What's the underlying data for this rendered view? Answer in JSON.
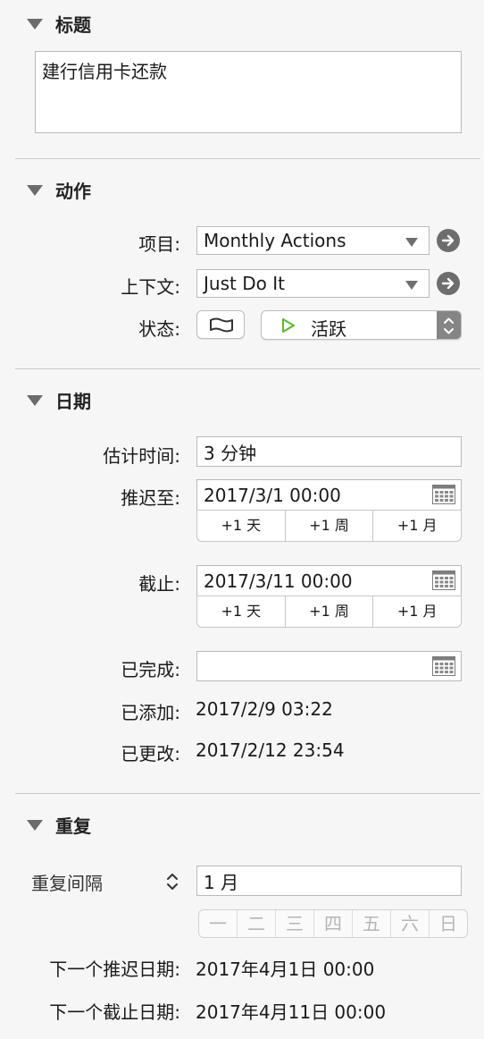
{
  "title_section": {
    "header": "标题",
    "title_value": "建行信用卡还款"
  },
  "action_section": {
    "header": "动作",
    "project_label": "项目:",
    "project_value": "Monthly Actions",
    "context_label": "上下文:",
    "context_value": "Just Do It",
    "status_label": "状态:",
    "status_value": "活跃"
  },
  "dates_section": {
    "header": "日期",
    "estimate_label": "估计时间:",
    "estimate_value": "3 分钟",
    "defer_label": "推迟至:",
    "defer_value": "2017/3/1 00:00",
    "due_label": "截止:",
    "due_value": "2017/3/11 00:00",
    "completed_label": "已完成:",
    "completed_value": "",
    "added_label": "已添加:",
    "added_value": "2017/2/9 03:22",
    "changed_label": "已更改:",
    "changed_value": "2017/2/12 23:54",
    "quick_add": [
      "+1 天",
      "+1 周",
      "+1 月"
    ]
  },
  "repeat_section": {
    "header": "重复",
    "mode_label": "重复间隔",
    "interval_value": "1 月",
    "weekdays": [
      "一",
      "二",
      "三",
      "四",
      "五",
      "六",
      "日"
    ],
    "next_defer_label": "下一个推迟日期:",
    "next_defer_value": "2017年4月1日 00:00",
    "next_due_label": "下一个截止日期:",
    "next_due_value": "2017年4月11日 00:00"
  },
  "colors": {
    "background": "#f6f6f6",
    "divider": "#c9c9c9",
    "active_green": "#5cb82e",
    "icon_gray": "#6d6d6d"
  },
  "icons": [
    "disclosure-triangle-icon",
    "go-arrow-icon",
    "flag-icon",
    "play-icon",
    "stepper-icon",
    "calendar-icon",
    "updown-chevron-icon"
  ]
}
